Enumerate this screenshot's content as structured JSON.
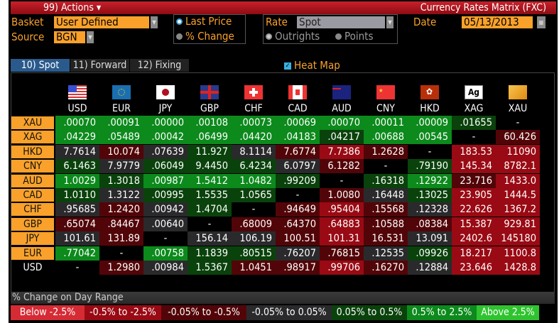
{
  "titlebar": {
    "actions": "99) Actions",
    "actions_caret": "▾",
    "title": "Currency Rates Matrix (FXC)"
  },
  "controls": {
    "basket_label": "Basket",
    "basket_value": "User Defined",
    "source_label": "Source",
    "source_value": "BGN",
    "price_options": [
      "Last Price",
      "% Change"
    ],
    "price_selected": 0,
    "rate_label": "Rate",
    "rate_value": "Spot",
    "quote_options": [
      "Outrights",
      "Points"
    ],
    "quote_selected": 0,
    "date_label": "Date",
    "date_value": "05/13/2013"
  },
  "tabs": [
    {
      "label": "10) Spot",
      "active": true
    },
    {
      "label": "11) Forward",
      "active": false
    },
    {
      "label": "12) Fixing",
      "active": false
    }
  ],
  "heatmap": {
    "label": "Heat Map",
    "checked": true
  },
  "columns": [
    "USD",
    "EUR",
    "JPY",
    "GBP",
    "CHF",
    "CAD",
    "AUD",
    "CNY",
    "HKD",
    "XAG",
    "XAU"
  ],
  "column_icons": [
    "us-flag-icon",
    "eu-flag-icon",
    "japan-flag-icon",
    "uk-flag-icon",
    "swiss-flag-icon",
    "canada-flag-icon",
    "australia-flag-icon",
    "china-flag-icon",
    "hong-kong-flag-icon",
    "silver-icon",
    "gold-icon"
  ],
  "colors": {
    "orange": "#f9a12b",
    "heat": [
      "#000000",
      "#d52b35",
      "#990a14",
      "#520508",
      "#2a2a2c",
      "#0a420c",
      "#0c8a1c",
      "#2fc42f"
    ]
  },
  "rows": [
    {
      "label": "XAU",
      "values": [
        ".00070",
        ".00091",
        ".00000",
        ".00108",
        ".00073",
        ".00069",
        ".00070",
        ".00011",
        ".00009",
        ".01655",
        "-"
      ],
      "heat": [
        6,
        6,
        6,
        6,
        6,
        6,
        6,
        6,
        6,
        5,
        0
      ]
    },
    {
      "label": "XAG",
      "values": [
        ".04229",
        ".05489",
        ".00042",
        ".06499",
        ".04420",
        ".04183",
        ".04217",
        ".00688",
        ".00545",
        "-",
        "60.426"
      ],
      "heat": [
        6,
        6,
        6,
        6,
        6,
        6,
        5,
        6,
        6,
        0,
        3
      ]
    },
    {
      "label": "HKD",
      "values": [
        "7.7614",
        "10.074",
        ".07639",
        "11.927",
        "8.1114",
        "7.6774",
        "7.7386",
        "1.2628",
        "-",
        "183.53",
        "11090"
      ],
      "heat": [
        4,
        3,
        4,
        5,
        4,
        3,
        2,
        3,
        0,
        2,
        2
      ]
    },
    {
      "label": "CNY",
      "values": [
        "6.1463",
        "7.9779",
        ".06049",
        "9.4450",
        "6.4234",
        "6.0797",
        "6.1282",
        "-",
        ".79190",
        "145.34",
        "8782.1"
      ],
      "heat": [
        5,
        4,
        5,
        5,
        5,
        4,
        3,
        0,
        5,
        2,
        2
      ]
    },
    {
      "label": "AUD",
      "values": [
        "1.0029",
        "1.3018",
        ".00987",
        "1.5412",
        "1.0482",
        ".99209",
        "-",
        ".16318",
        ".12922",
        "23.716",
        "1433.0"
      ],
      "heat": [
        6,
        5,
        6,
        6,
        6,
        5,
        0,
        5,
        6,
        3,
        2
      ]
    },
    {
      "label": "CAD",
      "values": [
        "1.0110",
        "1.3122",
        ".00995",
        "1.5535",
        "1.0565",
        "-",
        "1.0080",
        ".16448",
        ".13025",
        "23.905",
        "1444.5"
      ],
      "heat": [
        5,
        4,
        5,
        5,
        5,
        0,
        3,
        4,
        5,
        2,
        2
      ]
    },
    {
      "label": "CHF",
      "values": [
        ".95685",
        "1.2420",
        ".00942",
        "1.4704",
        "-",
        ".94649",
        ".95404",
        ".15568",
        ".12328",
        "22.626",
        "1367.2"
      ],
      "heat": [
        4,
        3,
        4,
        5,
        0,
        3,
        2,
        3,
        4,
        2,
        2
      ]
    },
    {
      "label": "GBP",
      "values": [
        ".65074",
        ".84467",
        ".00640",
        "-",
        ".68009",
        ".64370",
        ".64883",
        ".10588",
        ".08384",
        "15.387",
        "929.81"
      ],
      "heat": [
        3,
        3,
        4,
        0,
        3,
        3,
        2,
        3,
        3,
        2,
        2
      ]
    },
    {
      "label": "JPY",
      "values": [
        "101.61",
        "131.89",
        "-",
        "156.14",
        "106.19",
        "100.51",
        "101.31",
        "16.531",
        "13.091",
        "2402.6",
        "145180"
      ],
      "heat": [
        4,
        3,
        0,
        4,
        4,
        3,
        2,
        3,
        4,
        2,
        2
      ]
    },
    {
      "label": "EUR",
      "values": [
        ".77042",
        "-",
        ".00758",
        "1.1839",
        ".80515",
        ".76207",
        ".76815",
        ".12535",
        ".09926",
        "18.217",
        "1100.8"
      ],
      "heat": [
        6,
        0,
        6,
        5,
        5,
        4,
        3,
        4,
        5,
        2,
        2
      ]
    },
    {
      "label": "USD",
      "values": [
        "-",
        "1.2980",
        ".00984",
        "1.5367",
        "1.0451",
        ".98917",
        ".99706",
        ".16270",
        ".12884",
        "23.646",
        "1428.8"
      ],
      "heat": [
        0,
        3,
        4,
        5,
        3,
        3,
        2,
        3,
        4,
        2,
        2
      ],
      "plain": true
    }
  ],
  "legend": {
    "title": "% Change on Day Range",
    "items": [
      "Below -2.5%",
      "-0.5% to -2.5%",
      "-0.05% to -0.5%",
      "-0.05% to 0.05%",
      "0.05% to 0.5%",
      "0.5% to 2.5%",
      "Above 2.5%"
    ]
  }
}
